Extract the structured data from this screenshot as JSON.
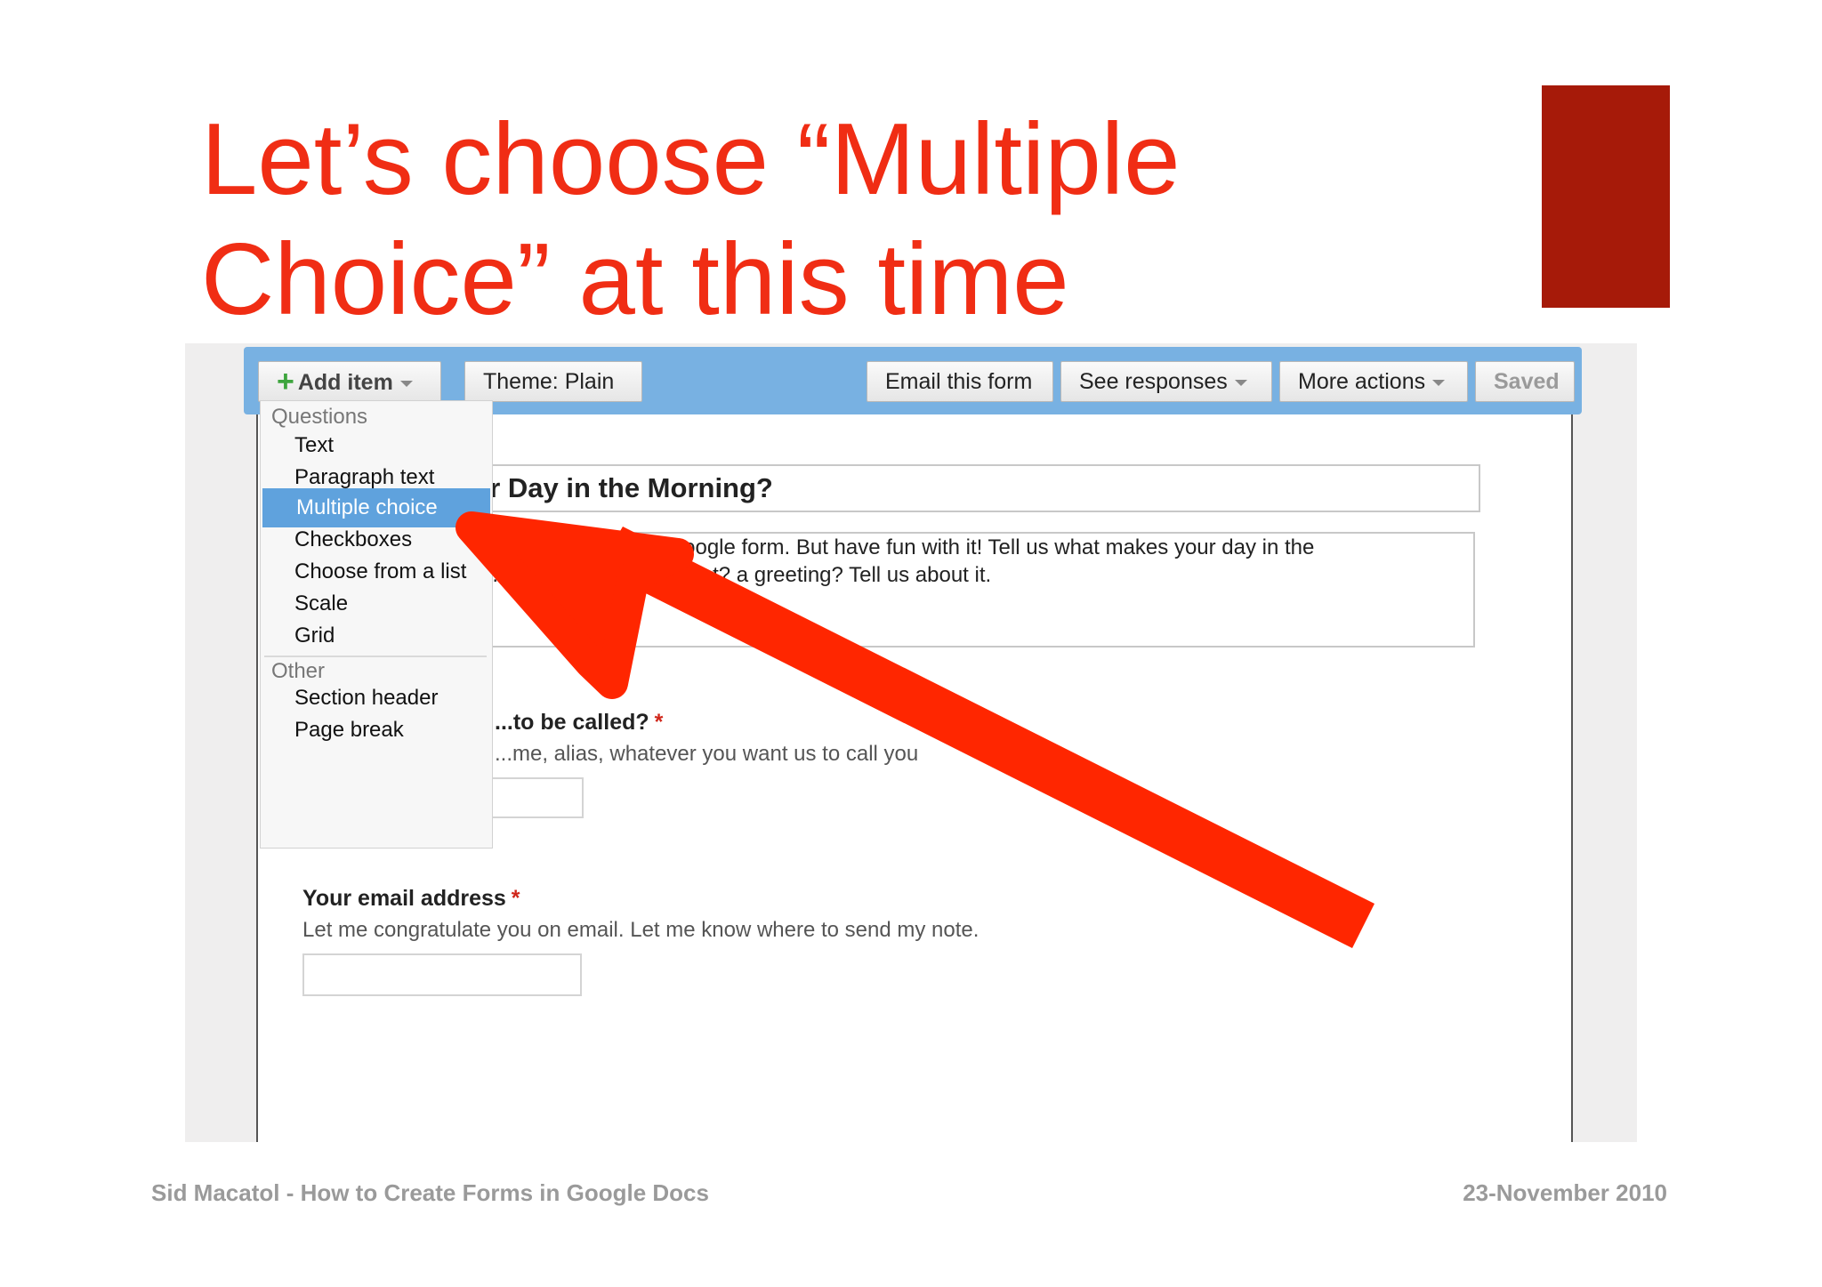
{
  "slide": {
    "title_line1": "Let’s choose “Multiple",
    "title_line2": "Choice” at this time",
    "footer_left": "Sid Macatol - How to Create Forms in Google Docs",
    "footer_right": "23-November 2010",
    "title_color": "#f02d14",
    "accent_color": "#a61a09",
    "arrow_color": "#ff2600"
  },
  "toolbar": {
    "add_item_icon": "plus-icon",
    "add_item_label": "Add item",
    "theme_label": "Theme:  Plain",
    "email_label": "Email this form",
    "responses_label": "See responses",
    "more_actions_label": "More actions",
    "saved_label": "Saved",
    "bar_color": "#78b1e2"
  },
  "menu": {
    "questions_header": "Questions",
    "question_items": [
      "Text",
      "Paragraph text",
      "Multiple choice",
      "Checkboxes",
      "Choose from a list",
      "Scale",
      "Grid"
    ],
    "selected_item": "Multiple choice",
    "other_header": "Other",
    "other_items": [
      "Section header",
      "Page break"
    ],
    "highlight_color": "#5fa2dd"
  },
  "form": {
    "title_visible": "Your Day in the Morning?",
    "description_line1": "...to practice creating a Google form. But have fun with it! Tell us what makes your day in the",
    "description_line2": "...ng... coffee? a smile? a pat? a greeting? Tell us about it.",
    "q1_label": "...to be called?",
    "q1_required": "*",
    "q1_help": "...me, alias, whatever you want us to call you",
    "q2_label": "Your email address",
    "q2_required": "*",
    "q2_help": "Let me congratulate you on email. Let me know where to send my note."
  }
}
